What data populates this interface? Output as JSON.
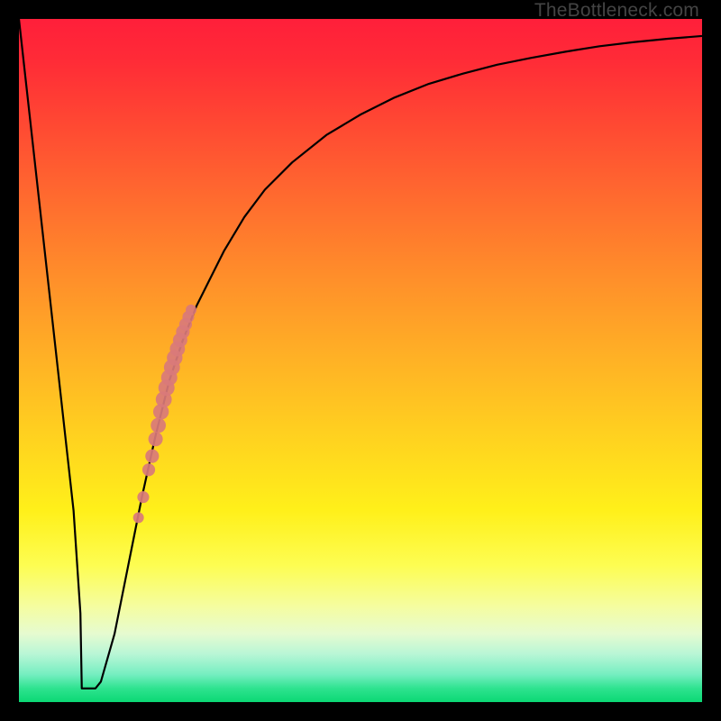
{
  "attribution": "TheBottleneck.com",
  "colors": {
    "frame": "#000000",
    "curve_stroke": "#000000",
    "marker_fill": "#d97a7a",
    "gradient_top": "#ff1f3a",
    "gradient_bottom": "#0bd874"
  },
  "chart_data": {
    "type": "line",
    "title": "",
    "xlabel": "",
    "ylabel": "",
    "xlim": [
      0,
      100
    ],
    "ylim": [
      0,
      100
    ],
    "x": [
      0,
      2,
      4,
      6,
      8,
      9,
      10,
      11,
      12,
      14,
      16,
      18,
      20,
      22,
      24,
      26,
      28,
      30,
      33,
      36,
      40,
      45,
      50,
      55,
      60,
      65,
      70,
      75,
      80,
      85,
      90,
      95,
      100
    ],
    "values": [
      100,
      82,
      64,
      46,
      28,
      13,
      3,
      2,
      3,
      10,
      20,
      30,
      39,
      47,
      53,
      58,
      62,
      66,
      71,
      75,
      79,
      83,
      86,
      88.5,
      90.5,
      92,
      93.3,
      94.3,
      95.2,
      96,
      96.6,
      97.1,
      97.5
    ],
    "flat_bottom": {
      "x_start": 9.2,
      "x_end": 11.2,
      "y": 2
    },
    "markers": {
      "description": "salmon-colored dots clustered along the rising limb of the curve",
      "points": [
        {
          "x": 17.5,
          "y": 27
        },
        {
          "x": 18.2,
          "y": 30
        },
        {
          "x": 19.0,
          "y": 34
        },
        {
          "x": 19.5,
          "y": 36
        },
        {
          "x": 20.0,
          "y": 38.5
        },
        {
          "x": 20.4,
          "y": 40.5
        },
        {
          "x": 20.8,
          "y": 42.5
        },
        {
          "x": 21.2,
          "y": 44.3
        },
        {
          "x": 21.6,
          "y": 46.0
        },
        {
          "x": 22.0,
          "y": 47.5
        },
        {
          "x": 22.4,
          "y": 49.0
        },
        {
          "x": 22.8,
          "y": 50.4
        },
        {
          "x": 23.2,
          "y": 51.7
        },
        {
          "x": 23.6,
          "y": 53.0
        },
        {
          "x": 24.0,
          "y": 54.2
        },
        {
          "x": 24.4,
          "y": 55.3
        },
        {
          "x": 24.8,
          "y": 56.4
        },
        {
          "x": 25.2,
          "y": 57.4
        }
      ]
    }
  }
}
